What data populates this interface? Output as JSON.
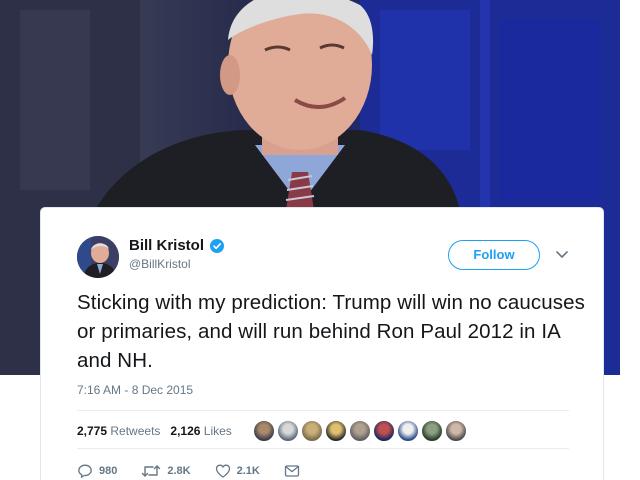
{
  "tweet": {
    "user_name": "Bill Kristol",
    "user_handle": "@BillKristol",
    "follow_label": "Follow",
    "text": "Sticking with my prediction: Trump will win no caucuses or primaries, and will run behind Ron Paul 2012 in IA and NH.",
    "timestamp": "7:16 AM - 8 Dec 2015",
    "retweets_count": "2,775",
    "retweets_label": "Retweets",
    "likes_count": "2,126",
    "likes_label": "Likes",
    "actions": {
      "reply_count": "980",
      "retweet_count": "2.8K",
      "like_count": "2.1K"
    }
  },
  "icons": {
    "verified": "verified-badge-icon",
    "more": "chevron-down-icon",
    "reply": "reply-icon",
    "retweet": "retweet-icon",
    "like": "heart-icon",
    "message": "envelope-icon"
  },
  "colors": {
    "accent": "#1da1f2",
    "text": "#14171a",
    "muted": "#657786"
  }
}
